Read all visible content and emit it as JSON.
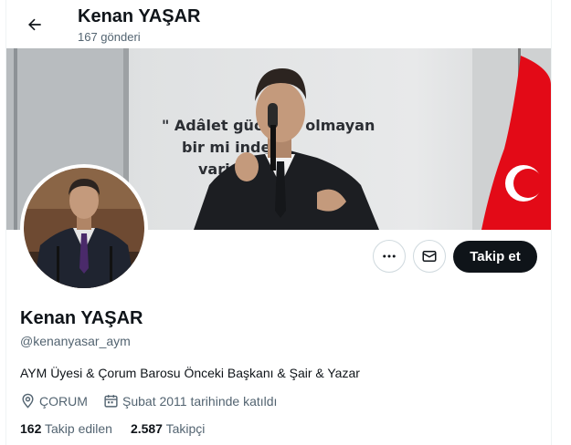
{
  "header": {
    "name": "Kenan YAŞAR",
    "posts_count": "167 gönderi"
  },
  "banner": {
    "wall_text_line1": "\" Adâlet gücü        sız olmayan",
    "wall_text_line2": "bir mi                      inde",
    "wall_text_line3": "vari"
  },
  "actions": {
    "more_icon": "more-horizontal-icon",
    "message_icon": "envelope-icon",
    "follow_label": "Takip et"
  },
  "profile": {
    "name": "Kenan YAŞAR",
    "handle": "@kenanyasar_aym",
    "bio": "AYM Üyesi & Çorum Barosu Önceki Başkanı & Şair & Yazar",
    "location": "ÇORUM",
    "joined": "Şubat 2011 tarihinde katıldı"
  },
  "stats": {
    "following_count": "162",
    "following_label": "Takip edilen",
    "followers_count": "2.587",
    "followers_label": "Takipçi"
  },
  "colors": {
    "text_primary": "#0f1419",
    "text_secondary": "#536471",
    "border": "#cfd9de",
    "follow_bg": "#0f1419",
    "flag_red": "#e30a17"
  }
}
